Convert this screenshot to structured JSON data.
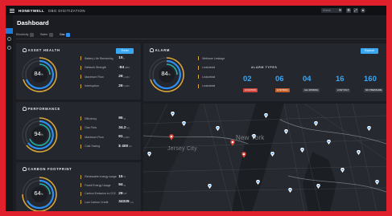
{
  "topbar": {
    "brand": "HONEYWELL",
    "product": "DBG DIGITIZATION",
    "search_placeholder": "Search"
  },
  "page": {
    "title": "Dashboard"
  },
  "tabs": [
    {
      "label": "Electricity",
      "active": false
    },
    {
      "label": "Water",
      "active": false
    },
    {
      "label": "Gas",
      "active": true
    }
  ],
  "asset_health": {
    "title": "ASSET HEALTH",
    "button": "Trend",
    "gauge_value": "84",
    "gauge_unit": "%",
    "rows": [
      {
        "label": "Battery Life Remaining",
        "value": "15",
        "unit": "h"
      },
      {
        "label": "Network Strength",
        "value": "-94",
        "unit": "dBm"
      },
      {
        "label": "Maximum Flow",
        "value": "29",
        "unit": "m3/hr"
      },
      {
        "label": "Interruption",
        "value": "29",
        "unit": "m3/hr"
      }
    ]
  },
  "alarm": {
    "title": "ALARM",
    "button": "Explore",
    "gauge_value": "84",
    "gauge_unit": "%",
    "legend": [
      "Methane Leakage",
      "Leakdetail",
      "Leakdetail",
      "Leakdetail"
    ],
    "types_title": "ALARM TYPES",
    "types": [
      {
        "count": "02",
        "tag": "LOCATION",
        "color": "#d2463c"
      },
      {
        "count": "06",
        "tag": "LOW BIAS",
        "color": "#c9622a"
      },
      {
        "count": "04",
        "tag": "ALL MISSING",
        "color": "#3a3e46"
      },
      {
        "count": "16",
        "tag": "LOW VOLT",
        "color": "#3a3e46"
      },
      {
        "count": "160",
        "tag": "NO PRESSURE",
        "color": "#3a3e46"
      }
    ]
  },
  "performance": {
    "title": "PERFORMANCE",
    "gauge_value": "94",
    "gauge_unit": "%",
    "rows": [
      {
        "label": "Efficiency",
        "value": "95",
        "unit": "%"
      },
      {
        "label": "Gas Flow",
        "value": "34.2",
        "unit": "kg"
      },
      {
        "label": "Maximum Flow",
        "value": "91",
        "unit": "m3/hr"
      },
      {
        "label": "Cost Saving",
        "value": "$ 400",
        "unit": "kd"
      }
    ]
  },
  "carbon": {
    "title": "CARBON FOOTPRINT",
    "gauge_value": "64",
    "gauge_unit": "%",
    "rows": [
      {
        "label": "Renewable energy usage",
        "value": "15",
        "unit": "%"
      },
      {
        "label": "Fossil Energy Usage",
        "value": "94",
        "unit": "%"
      },
      {
        "label": "Carbon Emission in CO2",
        "value": "29",
        "unit": "MT"
      },
      {
        "label": "Low Carbon Credit",
        "value": "34329",
        "unit": "CC"
      }
    ]
  },
  "map": {
    "city1": "Jersey City",
    "city2": "New York"
  },
  "colors": {
    "accent": "#3ba7f5",
    "gold": "#d8a53a",
    "frame": "#e0212d"
  }
}
